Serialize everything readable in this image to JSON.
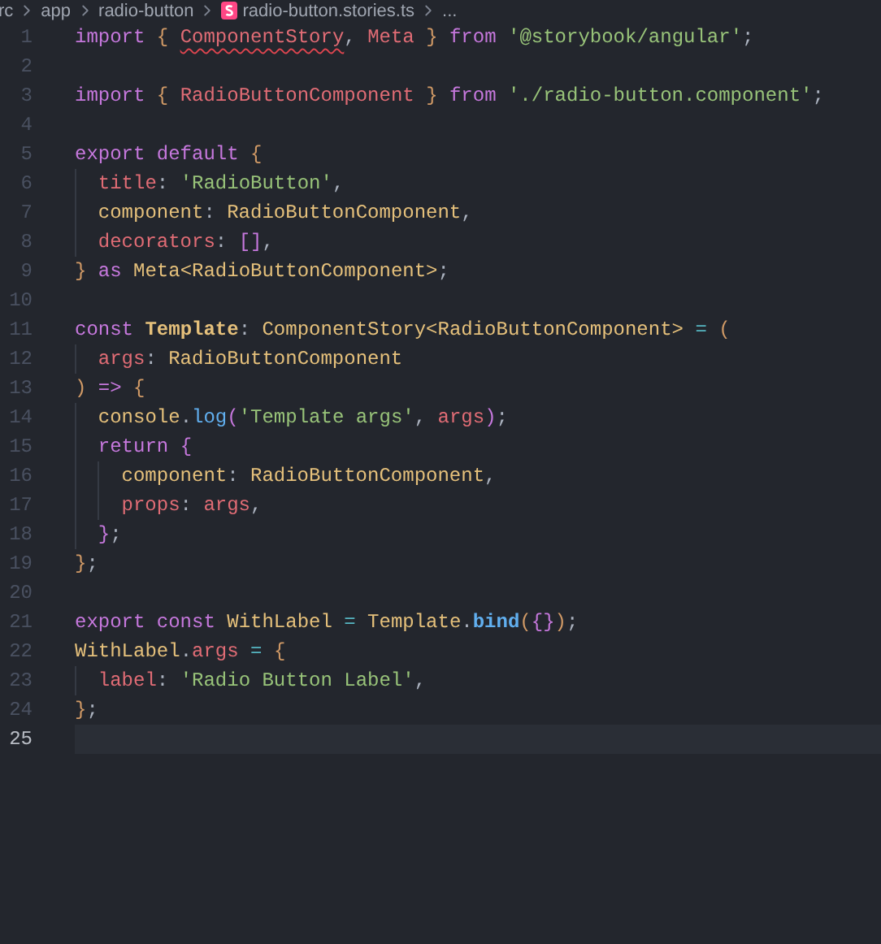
{
  "breadcrumb": [
    {
      "label": "rc",
      "kind": "folder"
    },
    {
      "label": "app",
      "kind": "folder"
    },
    {
      "label": "radio-button",
      "kind": "folder"
    },
    {
      "label": "radio-button.stories.ts",
      "kind": "file"
    },
    {
      "label": "...",
      "kind": "more"
    }
  ],
  "lines": [
    {
      "number": "1",
      "current": false,
      "tokens": [
        {
          "kind": "keyword",
          "text": "import "
        },
        {
          "kind": "bracket",
          "text": "{ "
        },
        {
          "kind": "error",
          "text": "ComponentStory"
        },
        {
          "kind": "punctuation",
          "text": ", "
        },
        {
          "kind": "identifier",
          "text": "Meta "
        },
        {
          "kind": "bracket",
          "text": "} "
        },
        {
          "kind": "keyword",
          "text": "from "
        },
        {
          "kind": "string",
          "text": "'@storybook/angular'"
        },
        {
          "kind": "punctuation",
          "text": ";"
        }
      ]
    },
    {
      "number": "2",
      "current": false
    },
    {
      "number": "3",
      "current": false,
      "tokens": [
        {
          "kind": "keyword",
          "text": "import "
        },
        {
          "kind": "bracket",
          "text": "{ "
        },
        {
          "kind": "identifier",
          "text": "RadioButtonComponent "
        },
        {
          "kind": "bracket",
          "text": "} "
        },
        {
          "kind": "keyword",
          "text": "from "
        },
        {
          "kind": "string",
          "text": "'./radio-button.component'"
        },
        {
          "kind": "punctuation",
          "text": ";"
        }
      ]
    },
    {
      "number": "4",
      "current": false
    },
    {
      "number": "5",
      "current": false,
      "tokens": [
        {
          "kind": "keyword",
          "text": "export default "
        },
        {
          "kind": "bracket",
          "text": "{"
        }
      ]
    },
    {
      "number": "6",
      "current": false,
      "tokens": [
        {
          "kind": "property",
          "text": "  title"
        },
        {
          "kind": "punctuation",
          "text": ": "
        },
        {
          "kind": "string",
          "text": "'RadioButton'"
        },
        {
          "kind": "punctuation",
          "text": ","
        }
      ]
    },
    {
      "number": "7",
      "current": false,
      "tokens": [
        {
          "kind": "type",
          "text": "  component"
        },
        {
          "kind": "punctuation",
          "text": ": "
        },
        {
          "kind": "type",
          "text": "RadioButtonComponent"
        },
        {
          "kind": "punctuation",
          "text": ","
        }
      ]
    },
    {
      "number": "8",
      "current": false,
      "tokens": [
        {
          "kind": "property",
          "text": "  decorators"
        },
        {
          "kind": "punctuation",
          "text": ": "
        },
        {
          "kind": "nested-bracket",
          "text": "[]"
        },
        {
          "kind": "punctuation",
          "text": ","
        }
      ]
    },
    {
      "number": "9",
      "current": false,
      "tokens": [
        {
          "kind": "bracket",
          "text": "} "
        },
        {
          "kind": "keyword",
          "text": "as "
        },
        {
          "kind": "type",
          "text": "Meta<RadioButtonComponent>"
        },
        {
          "kind": "punctuation",
          "text": ";"
        }
      ]
    },
    {
      "number": "10",
      "current": false
    },
    {
      "number": "11",
      "current": false,
      "tokens": [
        {
          "kind": "keyword",
          "text": "const "
        },
        {
          "kind": "declaration",
          "text": "Template"
        },
        {
          "kind": "punctuation",
          "text": ": "
        },
        {
          "kind": "type",
          "text": "ComponentStory<RadioButtonComponent> "
        },
        {
          "kind": "operator",
          "text": "= "
        },
        {
          "kind": "bracket",
          "text": "("
        }
      ]
    },
    {
      "number": "12",
      "current": false,
      "tokens": [
        {
          "kind": "property",
          "text": "  args"
        },
        {
          "kind": "punctuation",
          "text": ": "
        },
        {
          "kind": "type",
          "text": "RadioButtonComponent"
        }
      ]
    },
    {
      "number": "13",
      "current": false,
      "tokens": [
        {
          "kind": "bracket",
          "text": ") "
        },
        {
          "kind": "keyword",
          "text": "=> "
        },
        {
          "kind": "bracket",
          "text": "{"
        }
      ]
    },
    {
      "number": "14",
      "current": false,
      "tokens": [
        {
          "kind": "type",
          "text": "  console"
        },
        {
          "kind": "punctuation",
          "text": "."
        },
        {
          "kind": "function",
          "text": "log"
        },
        {
          "kind": "nested-bracket",
          "text": "("
        },
        {
          "kind": "string",
          "text": "'Template args'"
        },
        {
          "kind": "punctuation",
          "text": ", "
        },
        {
          "kind": "property",
          "text": "args"
        },
        {
          "kind": "nested-bracket",
          "text": ")"
        },
        {
          "kind": "punctuation",
          "text": ";"
        }
      ]
    },
    {
      "number": "15",
      "current": false,
      "tokens": [
        {
          "kind": "keyword",
          "text": "  return "
        },
        {
          "kind": "nested-bracket",
          "text": "{"
        }
      ]
    },
    {
      "number": "16",
      "current": false,
      "tokens": [
        {
          "kind": "type",
          "text": "    component"
        },
        {
          "kind": "punctuation",
          "text": ": "
        },
        {
          "kind": "type",
          "text": "RadioButtonComponent"
        },
        {
          "kind": "punctuation",
          "text": ","
        }
      ]
    },
    {
      "number": "17",
      "current": false,
      "tokens": [
        {
          "kind": "property",
          "text": "    props"
        },
        {
          "kind": "punctuation",
          "text": ": "
        },
        {
          "kind": "property",
          "text": "args"
        },
        {
          "kind": "punctuation",
          "text": ","
        }
      ]
    },
    {
      "number": "18",
      "current": false,
      "tokens": [
        {
          "kind": "nested-bracket",
          "text": "  }"
        },
        {
          "kind": "punctuation",
          "text": ";"
        }
      ]
    },
    {
      "number": "19",
      "current": false,
      "tokens": [
        {
          "kind": "bracket",
          "text": "}"
        },
        {
          "kind": "punctuation",
          "text": ";"
        }
      ]
    },
    {
      "number": "20",
      "current": false
    },
    {
      "number": "21",
      "current": false,
      "tokens": [
        {
          "kind": "keyword",
          "text": "export const "
        },
        {
          "kind": "type",
          "text": "WithLabel "
        },
        {
          "kind": "operator",
          "text": "= "
        },
        {
          "kind": "type",
          "text": "Template"
        },
        {
          "kind": "punctuation",
          "text": "."
        },
        {
          "kind": "method",
          "text": "bind"
        },
        {
          "kind": "bracket",
          "text": "("
        },
        {
          "kind": "nested-bracket",
          "text": "{}"
        },
        {
          "kind": "bracket",
          "text": ")"
        },
        {
          "kind": "punctuation",
          "text": ";"
        }
      ]
    },
    {
      "number": "22",
      "current": false,
      "tokens": [
        {
          "kind": "type",
          "text": "WithLabel"
        },
        {
          "kind": "punctuation",
          "text": "."
        },
        {
          "kind": "property",
          "text": "args "
        },
        {
          "kind": "operator",
          "text": "= "
        },
        {
          "kind": "bracket",
          "text": "{"
        }
      ]
    },
    {
      "number": "23",
      "current": false,
      "tokens": [
        {
          "kind": "property",
          "text": "  label"
        },
        {
          "kind": "punctuation",
          "text": ": "
        },
        {
          "kind": "string",
          "text": "'Radio Button Label'"
        },
        {
          "kind": "punctuation",
          "text": ","
        }
      ]
    },
    {
      "number": "24",
      "current": false,
      "tokens": [
        {
          "kind": "bracket",
          "text": "}"
        },
        {
          "kind": "punctuation",
          "text": ";"
        }
      ]
    },
    {
      "number": "25",
      "current": true
    }
  ]
}
